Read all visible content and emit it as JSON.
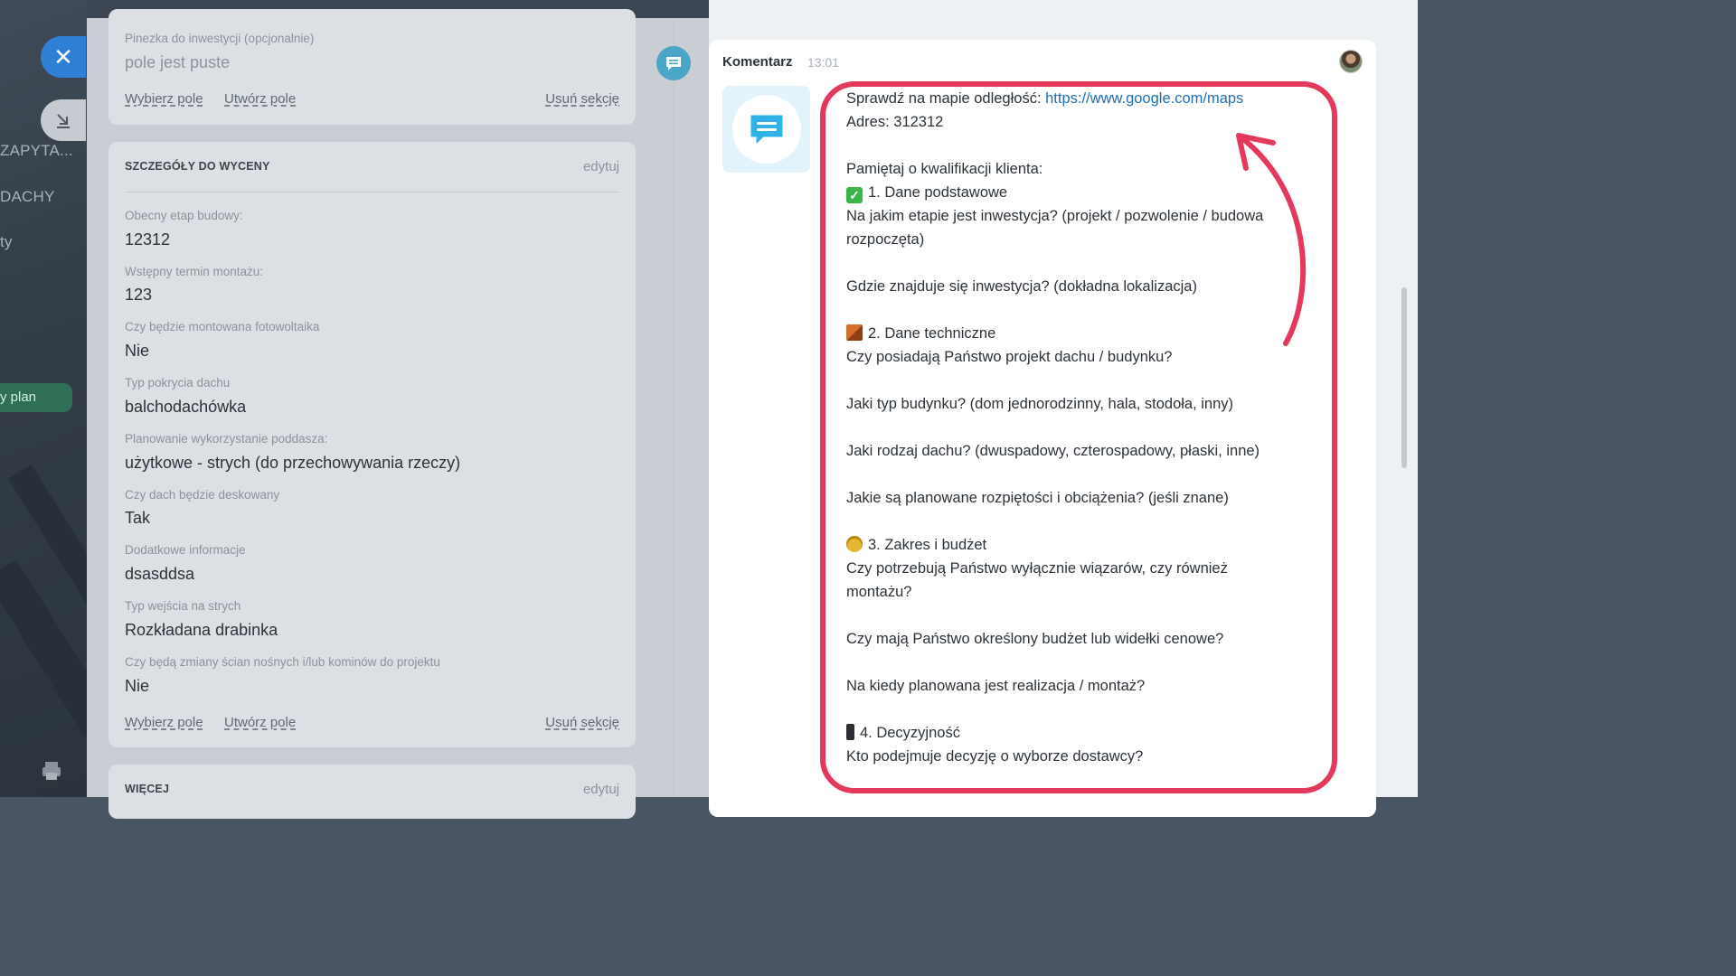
{
  "sidebar": {
    "nav_items": [
      "ZAPYTA...",
      "DACHY",
      "ty"
    ],
    "plan_badge": "y plan",
    "close_icon": "close-icon",
    "minimize_icon": "minimize-icon"
  },
  "form": {
    "pin_section": {
      "label": "Pinezka do inwestycji (opcjonalnie)",
      "value": "pole jest puste",
      "actions": {
        "select": "Wybierz pole",
        "create": "Utwórz pole",
        "delete": "Usuń sekcję"
      }
    },
    "details_section": {
      "title": "SZCZEGÓŁY DO WYCENY",
      "edit": "edytuj",
      "fields": [
        {
          "label": "Obecny etap budowy:",
          "value": "12312"
        },
        {
          "label": "Wstępny termin montażu:",
          "value": "123"
        },
        {
          "label": "Czy będzie montowana fotowoltaika",
          "value": "Nie"
        },
        {
          "label": "Typ pokrycia dachu",
          "value": "balchodachówka"
        },
        {
          "label": "Planowanie wykorzystanie poddasza:",
          "value": "użytkowe - strych (do przechowywania rzeczy)"
        },
        {
          "label": "Czy dach będzie deskowany",
          "value": "Tak"
        },
        {
          "label": "Dodatkowe informacje",
          "value": "dsasddsa"
        },
        {
          "label": "Typ wejścia na strych",
          "value": "Rozkładana drabinka"
        },
        {
          "label": "Czy będą zmiany ścian nośnych i/lub kominów do projektu",
          "value": "Nie"
        }
      ],
      "actions": {
        "select": "Wybierz pole",
        "create": "Utwórz pole",
        "delete": "Usuń sekcję"
      }
    },
    "more_section": {
      "title": "WIĘCEJ",
      "edit": "edytuj"
    }
  },
  "comment": {
    "title": "Komentarz",
    "time": "13:01",
    "lines": {
      "l1_prefix": "Sprawdź na mapie odległość: ",
      "l1_link": "https://www.google.com/maps",
      "l2": "Adres: 312312",
      "l3": "Pamiętaj o kwalifikacji klienta:",
      "s1_title": "1. Dane podstawowe",
      "s1_q1": "Na jakim etapie jest inwestycja? (projekt / pozwolenie / budowa rozpoczęta)",
      "s1_q2": "Gdzie znajduje się inwestycja? (dokładna lokalizacja)",
      "s2_title": "2. Dane techniczne",
      "s2_q1": "Czy posiadają Państwo projekt dachu / budynku?",
      "s2_q2": "Jaki typ budynku? (dom jednorodzinny, hala, stodoła, inny)",
      "s2_q3": "Jaki rodzaj dachu? (dwuspadowy, czterospadowy, płaski, inne)",
      "s2_q4": "Jakie są planowane rozpiętości i obciążenia? (jeśli znane)",
      "s3_title": "3. Zakres i budżet",
      "s3_q1": "Czy potrzebują Państwo wyłącznie wiązarów, czy również montażu?",
      "s3_q2": "Czy mają Państwo określony budżet lub widełki cenowe?",
      "s3_q3": "Na kiedy planowana jest realizacja / montaż?",
      "s4_title": "4. Decyzyjność",
      "s4_q1": "Kto podejmuje decyzję o wyborze dostawcy?"
    },
    "emoji_icons": [
      "check-mark-icon",
      "brick-icon",
      "money-bag-icon",
      "mobile-phone-icon"
    ]
  },
  "colors": {
    "highlight": "#e5385d",
    "link": "#1f6fb8",
    "close_button": "#2f7fd6",
    "comment_dot": "#4aa5c7"
  }
}
